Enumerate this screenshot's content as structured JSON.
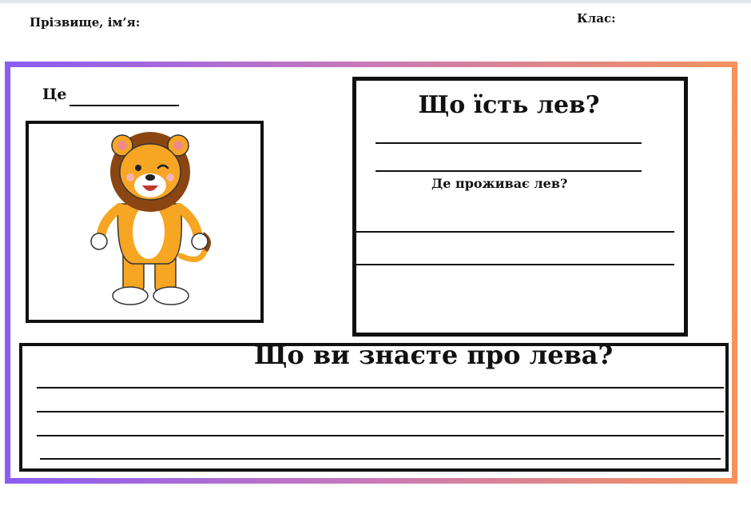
{
  "header": {
    "name_label": "Прізвище, ім’я:",
    "class_label": "Клас:"
  },
  "picture": {
    "ce_label": "Це",
    "image_subject": "lion-illustration"
  },
  "questions": {
    "what_eats": "Що їсть лев?",
    "where_lives": "Де проживає лев?",
    "what_know": "Що ви знаєте про лева?"
  },
  "colors": {
    "frame_gradient": [
      "#8a5cf6",
      "#c97ab8",
      "#f4935a"
    ],
    "lion_orange": "#f6a623",
    "lion_mane": "#8b4513"
  }
}
